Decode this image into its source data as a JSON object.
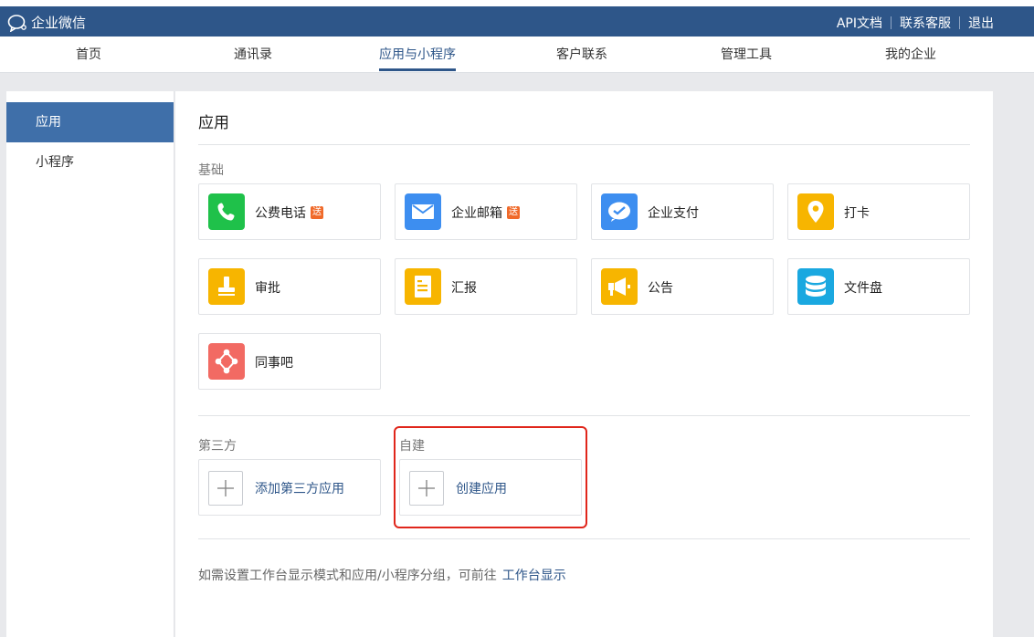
{
  "brand": {
    "name": "企业微信"
  },
  "header_links": [
    "API文档",
    "联系客服",
    "退出"
  ],
  "nav": [
    {
      "label": "首页"
    },
    {
      "label": "通讯录"
    },
    {
      "label": "应用与小程序",
      "active": true
    },
    {
      "label": "客户联系"
    },
    {
      "label": "管理工具"
    },
    {
      "label": "我的企业"
    }
  ],
  "sidebar": [
    {
      "label": "应用",
      "active": true
    },
    {
      "label": "小程序"
    }
  ],
  "main": {
    "title": "应用",
    "basic_label": "基础",
    "basic_apps": [
      {
        "label": "公费电话",
        "badge": "送",
        "icon": "phone-icon",
        "color": "#1fc14a"
      },
      {
        "label": "企业邮箱",
        "badge": "送",
        "icon": "mail-icon",
        "color": "#3d8ef0"
      },
      {
        "label": "企业支付",
        "badge": "",
        "icon": "pay-icon",
        "color": "#3d8ef0"
      },
      {
        "label": "打卡",
        "badge": "",
        "icon": "location-pin-icon",
        "color": "#f7b500"
      },
      {
        "label": "审批",
        "badge": "",
        "icon": "stamp-icon",
        "color": "#f7b500"
      },
      {
        "label": "汇报",
        "badge": "",
        "icon": "report-icon",
        "color": "#f7b500"
      },
      {
        "label": "公告",
        "badge": "",
        "icon": "megaphone-icon",
        "color": "#f7b500"
      },
      {
        "label": "文件盘",
        "badge": "",
        "icon": "database-icon",
        "color": "#1aa8e0"
      },
      {
        "label": "同事吧",
        "badge": "",
        "icon": "network-icon",
        "color": "#f26a63"
      }
    ],
    "third_party_label": "第三方",
    "third_party_add": "添加第三方应用",
    "custom_label": "自建",
    "custom_create": "创建应用",
    "footer_text": "如需设置工作台显示模式和应用/小程序分组，可前往",
    "footer_link": "工作台显示"
  }
}
